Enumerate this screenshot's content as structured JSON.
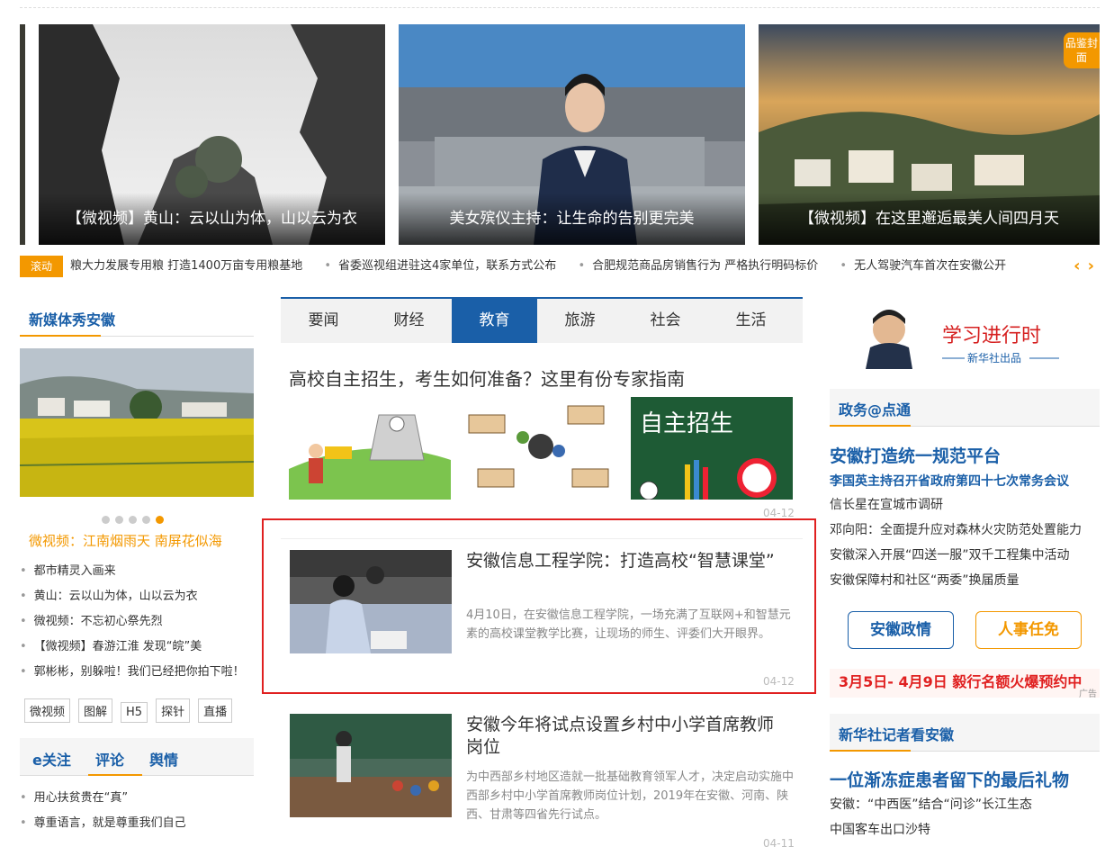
{
  "carousel": [
    {
      "caption": "【微视频】黄山：云以山为体，山以云为衣"
    },
    {
      "caption": "美女殡仪主持：让生命的告别更完美"
    },
    {
      "caption": "【微视频】在这里邂逅最美人间四月天",
      "badge": "品鉴封面"
    }
  ],
  "ticker": {
    "tag": "滚动",
    "items": [
      "粮大力发展专用粮 打造1400万亩专用粮基地",
      "省委巡视组进驻这4家单位，联系方式公布",
      "合肥规范商品房销售行为 严格执行明码标价",
      "无人驾驶汽车首次在安徽公开"
    ],
    "prev": "‹",
    "next": "›"
  },
  "left": {
    "section_title": "新媒体秀安徽",
    "feature_title": "微视频：江南烟雨天 南屏花似海",
    "list": [
      "都市精灵入画来",
      "黄山：云以山为体，山以云为衣",
      "微视频：不忘初心祭先烈",
      "【微视频】春游江淮 发现“皖”美",
      "郭彬彬，别躲啦！我们已经把你拍下啦！"
    ],
    "tags": [
      "微视频",
      "图解",
      "H5",
      "探针",
      "直播"
    ],
    "tabs": [
      "e关注",
      "评论",
      "舆情"
    ],
    "bottom_list": [
      "用心扶贫贵在“真”",
      "尊重语言，就是尊重我们自己"
    ]
  },
  "middle": {
    "tabs": [
      "要闻",
      "财经",
      "教育",
      "旅游",
      "社会",
      "生活"
    ],
    "active_tab": "教育",
    "headline": "高校自主招生，考生如何准备？这里有份专家指南",
    "thumb_label": "自主招生",
    "headline_date": "04-12",
    "articles": [
      {
        "title": "安徽信息工程学院：打造高校“智慧课堂”",
        "desc": "4月10日，在安徽信息工程学院，一场充满了互联网+和智慧元素的高校课堂教学比赛，让现场的师生、评委们大开眼界。",
        "date": "04-12"
      },
      {
        "title": "安徽今年将试点设置乡村中小学首席教师岗位",
        "desc": "为中西部乡村地区造就一批基础教育领军人才，决定启动实施中西部乡村中小学首席教师岗位计划，2019年在安徽、河南、陕西、甘肃等四省先行试点。",
        "date": "04-11"
      }
    ]
  },
  "right": {
    "banner_title": "学习进行时",
    "banner_sub": "新华社出品",
    "section1": "政务@点通",
    "big1": "安徽打造统一规范平台",
    "sub1": "李国英主持召开省政府第四十七次常务会议",
    "list1": [
      "信长星在宣城市调研",
      "邓向阳：全面提升应对森林火灾防范处置能力",
      "安徽深入开展“四送一服”双千工程集中活动",
      "安徽保障村和社区“两委”换届质量"
    ],
    "btn1": "安徽政情",
    "btn2": "人事任免",
    "ad_text": "3月5日- 4月9日 毅行名额火爆预约中",
    "ad_label": "广告",
    "section2": "新华社记者看安徽",
    "big2": "一位渐冻症患者留下的最后礼物",
    "list2": [
      "安徽：“中西医”结合“问诊”长江生态",
      "中国客车出口沙特"
    ]
  }
}
